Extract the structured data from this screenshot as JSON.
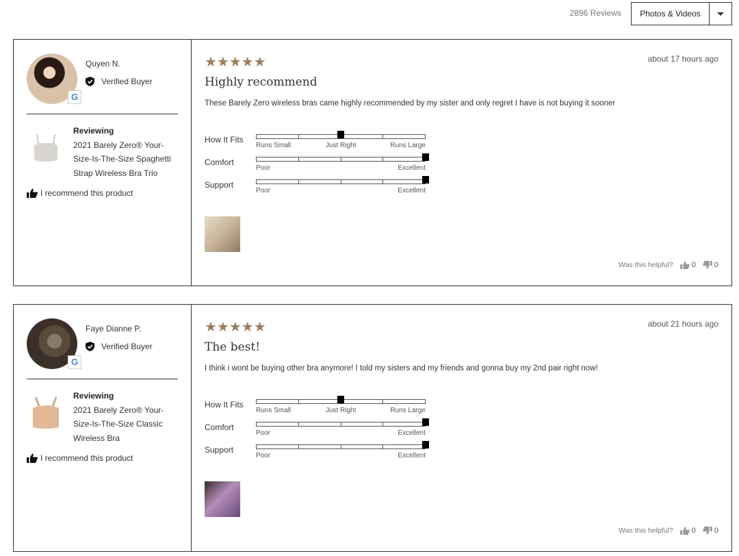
{
  "header": {
    "review_count": "2896 Reviews",
    "filter_label": "Photos & Videos"
  },
  "reviews": [
    {
      "author": "Quyen N.",
      "verified": "Verified Buyer",
      "reviewing_heading": "Reviewing",
      "product_name": "2021 Barely Zero® Your-Size-Is-The-Size Spaghetti Strap Wireless Bra Trio",
      "recommend": "I recommend this product",
      "stars": "★★★★★",
      "rating": 5,
      "timestamp": "about 17 hours ago",
      "title": "Highly recommend",
      "body": "These Barely Zero wireless bras came highly recommended by my sister and only regret I have is not buying it sooner",
      "fit": {
        "label": "How It Fits",
        "low": "Runs Small",
        "mid": "Just Right",
        "high": "Runs Large",
        "value": 0.5
      },
      "comfort": {
        "label": "Comfort",
        "low": "Poor",
        "high": "Excellent",
        "value": 1.0
      },
      "support": {
        "label": "Support",
        "low": "Poor",
        "high": "Excellent",
        "value": 1.0
      },
      "helpful_label": "Was this helpful?",
      "upvotes": "0",
      "downvotes": "0"
    },
    {
      "author": "Faye Dianne P.",
      "verified": "Verified Buyer",
      "reviewing_heading": "Reviewing",
      "product_name": "2021 Barely Zero® Your-Size-Is-The-Size Classic Wireless Bra",
      "recommend": "I recommend this product",
      "stars": "★★★★★",
      "rating": 5,
      "timestamp": "about 21 hours ago",
      "title": "The best!",
      "body": "I think i wont be buying other bra anymore! I told my sisters and my friends and gonna buy my 2nd pair right now!",
      "fit": {
        "label": "How It Fits",
        "low": "Runs Small",
        "mid": "Just Right",
        "high": "Runs Large",
        "value": 0.5
      },
      "comfort": {
        "label": "Comfort",
        "low": "Poor",
        "high": "Excellent",
        "value": 1.0
      },
      "support": {
        "label": "Support",
        "low": "Poor",
        "high": "Excellent",
        "value": 1.0
      },
      "helpful_label": "Was this helpful?",
      "upvotes": "0",
      "downvotes": "0"
    }
  ],
  "colors": {
    "star": "#a07d5a",
    "border": "#333333"
  }
}
